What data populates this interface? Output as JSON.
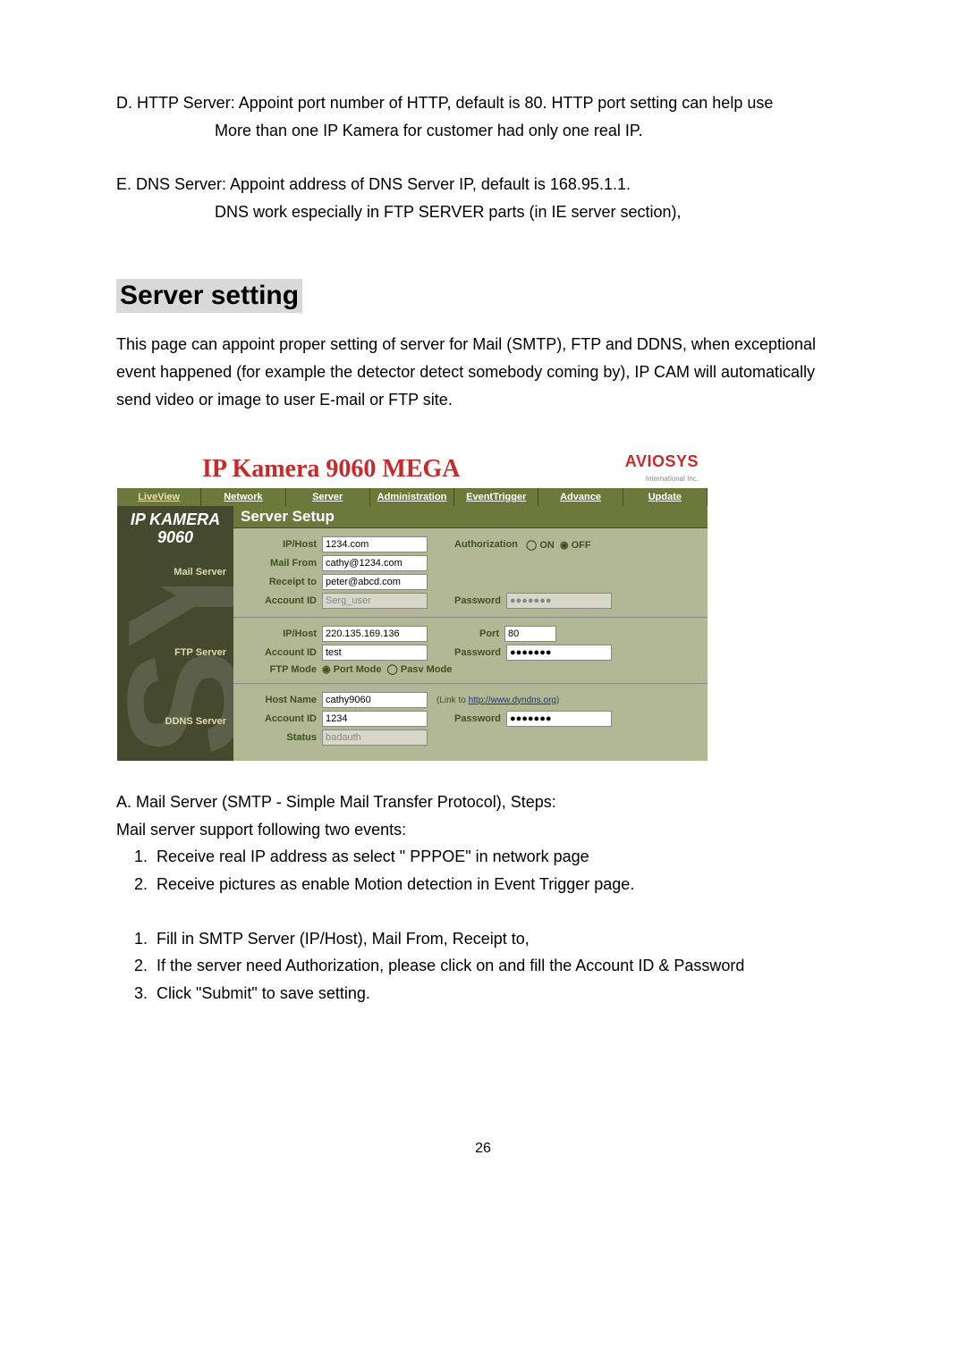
{
  "paraD_line1": "D. HTTP Server: Appoint port number of HTTP, default is 80. HTTP port setting can help use",
  "paraD_line2": "More than one IP Kamera for customer had only one real IP.",
  "paraE_line1": "E. DNS Server: Appoint address of DNS Server IP, default is 168.95.1.1.",
  "paraE_line2": "DNS work especially in FTP SERVER parts (in IE server section),",
  "heading": "Server setting",
  "intro": "This page can appoint proper setting of server for Mail (SMTP), FTP and DDNS, when exceptional event happened (for example the detector detect somebody coming by), IP CAM will automatically send video or image to user E-mail or FTP site.",
  "ss": {
    "title": "IP Kamera 9060 MEGA",
    "logo_main": "AVIOSYS",
    "logo_sub": "International Inc.",
    "tabs": [
      "LiveView",
      "Network",
      "Server",
      "Administration",
      "EventTrigger",
      "Advance",
      "Update"
    ],
    "sidebar_title1": "IP KAMERA",
    "sidebar_title2": "9060",
    "sidebar_labels": {
      "mail": "Mail Server",
      "ftp": "FTP Server",
      "ddns": "DDNS Server"
    },
    "section_title": "Server Setup",
    "labels": {
      "ip_host": "IP/Host",
      "mail_from": "Mail From",
      "receipt_to": "Receipt to",
      "account_id": "Account ID",
      "authorization": "Authorization",
      "on": "ON",
      "off": "OFF",
      "password": "Password",
      "port": "Port",
      "ftp_mode": "FTP Mode",
      "port_mode": "Port Mode",
      "pasv_mode": "Pasv Mode",
      "host_name": "Host Name",
      "status": "Status",
      "link_to": "(Link to ",
      "link_url": "http://www.dyndns.org",
      "link_close": ")"
    },
    "values": {
      "mail_iphost": "1234.com",
      "mail_from": "cathy@1234.com",
      "mail_receipt": "peter@abcd.com",
      "mail_account": "Serg_user",
      "mail_password": "●●●●●●●",
      "ftp_iphost": "220.135.169.136",
      "ftp_port": "80",
      "ftp_account": "test",
      "ftp_password": "●●●●●●●",
      "ddns_hostname": "cathy9060",
      "ddns_account": "1234",
      "ddns_password": "●●●●●●●",
      "ddns_status": "badauth"
    }
  },
  "afterA_line1": "A. Mail Server (SMTP - Simple Mail Transfer Protocol), Steps:",
  "afterA_line2": "Mail server support following two events:",
  "list1": [
    "Receive real IP address as select \" PPPOE\" in network page",
    "Receive pictures as enable Motion detection in Event Trigger page."
  ],
  "list2": [
    "Fill in SMTP Server (IP/Host), Mail From, Receipt to,",
    "If the server need Authorization, please click on and fill the Account ID & Password",
    "Click \"Submit\" to save setting."
  ],
  "page_num": "26"
}
